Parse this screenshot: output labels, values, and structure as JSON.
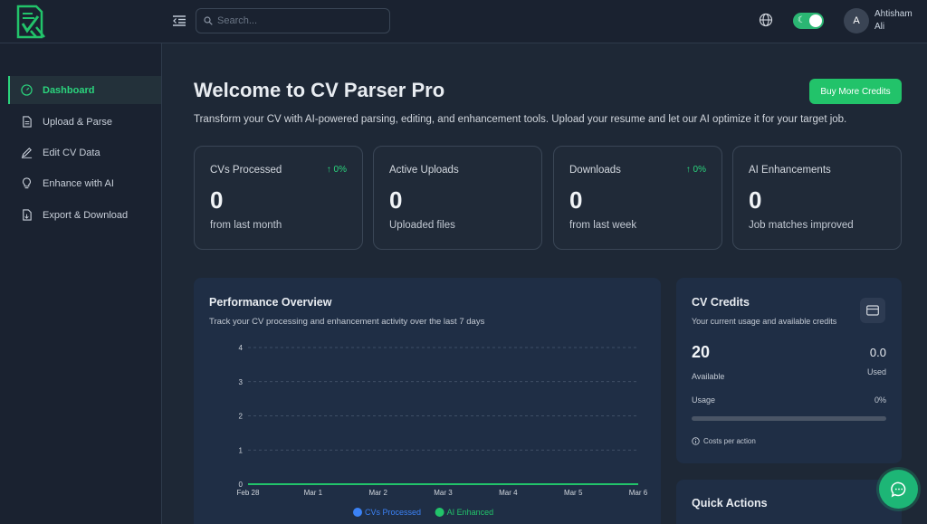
{
  "header": {
    "search_placeholder": "Search...",
    "user": {
      "initial": "A",
      "name": "Ahtisham Ali"
    },
    "dark_mode_on": true
  },
  "sidebar": {
    "items": [
      {
        "label": "Dashboard",
        "icon": "gauge-icon",
        "active": true
      },
      {
        "label": "Upload & Parse",
        "icon": "file-icon",
        "active": false
      },
      {
        "label": "Edit CV Data",
        "icon": "pencil-icon",
        "active": false
      },
      {
        "label": "Enhance with AI",
        "icon": "lightbulb-icon",
        "active": false
      },
      {
        "label": "Export & Download",
        "icon": "document-export-icon",
        "active": false
      }
    ]
  },
  "main": {
    "title": "Welcome to CV Parser Pro",
    "subtitle": "Transform your CV with AI-powered parsing, editing, and enhancement tools. Upload your resume and let our AI optimize it for your target job.",
    "buy_button": "Buy More Credits",
    "stats": [
      {
        "label": "CVs Processed",
        "trend": "0%",
        "value": "0",
        "note": "from last month"
      },
      {
        "label": "Active Uploads",
        "trend": "",
        "value": "0",
        "note": "Uploaded files"
      },
      {
        "label": "Downloads",
        "trend": "0%",
        "value": "0",
        "note": "from last week"
      },
      {
        "label": "AI Enhancements",
        "trend": "",
        "value": "0",
        "note": "Job matches improved"
      }
    ]
  },
  "performance": {
    "title": "Performance Overview",
    "subtitle": "Track your CV processing and enhancement activity over the last 7 days"
  },
  "chart_data": {
    "type": "line",
    "categories": [
      "Feb 28",
      "Mar 1",
      "Mar 2",
      "Mar 3",
      "Mar 4",
      "Mar 5",
      "Mar 6"
    ],
    "series": [
      {
        "name": "CVs Processed",
        "values": [
          0,
          0,
          0,
          0,
          0,
          0,
          0
        ],
        "color": "#3b82f6"
      },
      {
        "name": "AI Enhanced",
        "values": [
          0,
          0,
          0,
          0,
          0,
          0,
          0
        ],
        "color": "#22c36a"
      }
    ],
    "yticks": [
      "0",
      "1",
      "2",
      "3",
      "4"
    ],
    "ylim": [
      0,
      4
    ],
    "grid": true,
    "legend": "bottom"
  },
  "credits": {
    "title": "CV Credits",
    "subtitle": "Your current usage and available credits",
    "available_value": "20",
    "available_label": "Available",
    "used_value": "0.0",
    "used_label": "Used",
    "usage_label": "Usage",
    "usage_percent": "0%",
    "usage_fraction": 0,
    "costs_label": "Costs per action"
  },
  "quick_actions": {
    "title": "Quick Actions"
  },
  "colors": {
    "accent": "#22c36a",
    "panel": "#1f2e45",
    "background": "#1e2836"
  }
}
